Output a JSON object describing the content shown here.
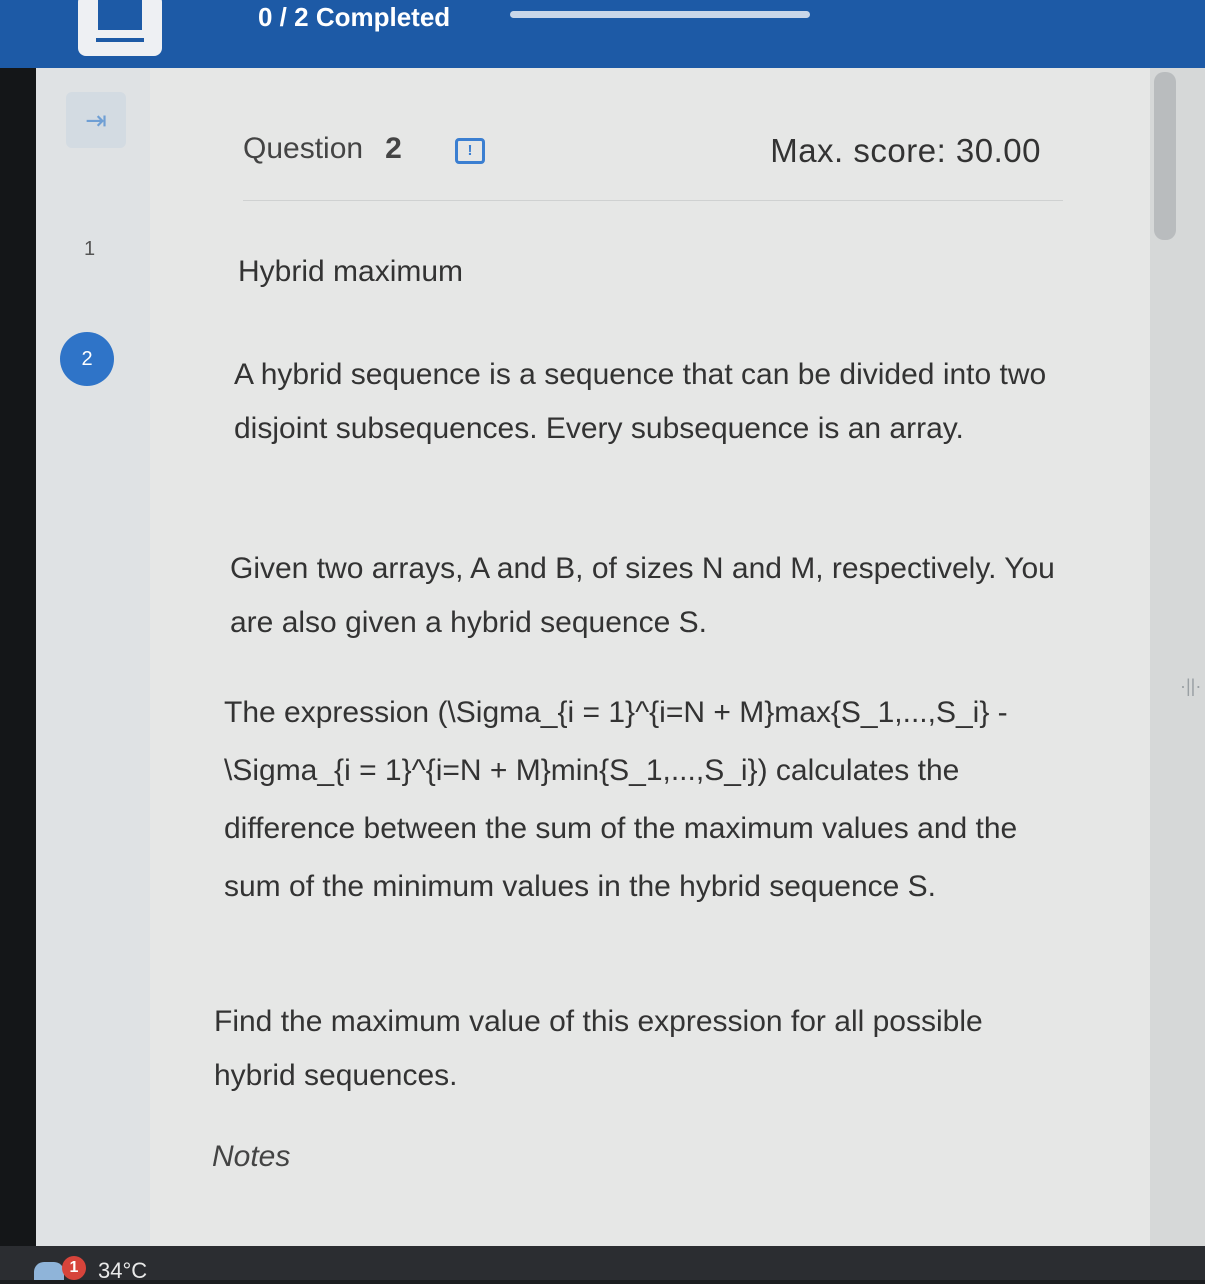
{
  "header": {
    "progress_text": "0 / 2 Completed",
    "progress_fraction": 0.0,
    "logo_icon": "logo-icon"
  },
  "sidebar": {
    "expand_icon": "⇥",
    "questions": [
      {
        "label": "1",
        "active": false
      },
      {
        "label": "2",
        "active": true
      }
    ]
  },
  "question": {
    "label": "Question",
    "number": "2",
    "flag_icon": "!",
    "max_score": "Max. score: 30.00",
    "title": "Hybrid maximum",
    "paragraph_1": "A hybrid sequence is a sequence that can be divided into two disjoint subsequences. Every subsequence is an array.",
    "paragraph_2": "Given two arrays, A and B, of sizes N and M, respectively. You are also given a hybrid sequence S.",
    "paragraph_3": "The expression (\\Sigma_{i = 1}^{i=N + M}max{S_1,...,S_i} - \\Sigma_{i = 1}^{i=N + M}min{S_1,...,S_i}) calculates the difference between the sum of the maximum values and the sum of the minimum values in the hybrid sequence S.",
    "paragraph_4": "Find the maximum value of this expression for all possible hybrid sequences.",
    "notes_heading": "Notes"
  },
  "taskbar": {
    "notification_count": "1",
    "temperature": "34°C"
  },
  "colors": {
    "brand": "#1d5aa6",
    "accent": "#2f74c8",
    "alert": "#d7443b"
  }
}
